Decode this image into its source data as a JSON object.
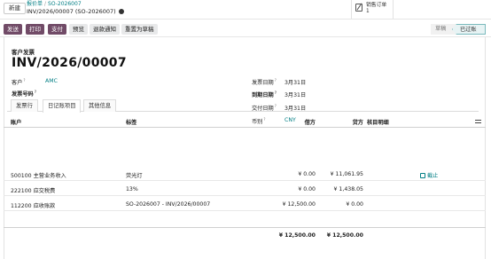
{
  "topbar": {
    "new_label": "新建",
    "breadcrumb": [
      "报价单",
      "SO-2026007"
    ],
    "breadcrumb_sep": "/",
    "record_title": "INV/2026/00007 (SO-2026007)",
    "smart_button": {
      "label": "销售订单",
      "count": "1"
    }
  },
  "actions": {
    "send": "发送",
    "print": "打印",
    "pay": "支付",
    "preview": "预览",
    "credit_note": "退款通知",
    "reset_draft": "重置为草稿"
  },
  "statusbar": {
    "draft": "草稿",
    "posted": "已过账"
  },
  "document": {
    "type_label": "客户发票",
    "number": "INV/2026/00007"
  },
  "fields": {
    "customer_label": "客户",
    "customer_value": "AMC",
    "invoice_ref_label": "发票号码",
    "invoice_date_label": "发票日期",
    "invoice_date_value": "3月31日",
    "due_date_label": "到期日期",
    "due_date_value": "3月31日",
    "delivery_date_label": "交付日期",
    "delivery_date_value": "3月31日",
    "currency_label": "币别",
    "currency_value": "CNY",
    "help_mark": "?"
  },
  "tabs": [
    {
      "label": "发票行"
    },
    {
      "label": "日记账项目"
    },
    {
      "label": "其他信息"
    }
  ],
  "table": {
    "headers": {
      "account": "账户",
      "label": "标签",
      "debit": "借方",
      "credit": "贷方",
      "matching": "核目明细"
    },
    "rows": [
      {
        "account": "500100 主营业务收入",
        "label": "荧光灯",
        "debit": "¥ 0.00",
        "credit": "¥ 11,061.95",
        "matching": "截止"
      },
      {
        "account": "222100 应交税费",
        "label": "13%",
        "debit": "¥ 0.00",
        "credit": "¥ 1,438.05",
        "matching": ""
      },
      {
        "account": "112200 应收账款",
        "label": "SO-2026007 - INV/2026/00007",
        "debit": "¥ 12,500.00",
        "credit": "¥ 0.00",
        "matching": ""
      }
    ],
    "totals": {
      "debit": "¥ 12,500.00",
      "credit": "¥ 12,500.00"
    }
  }
}
